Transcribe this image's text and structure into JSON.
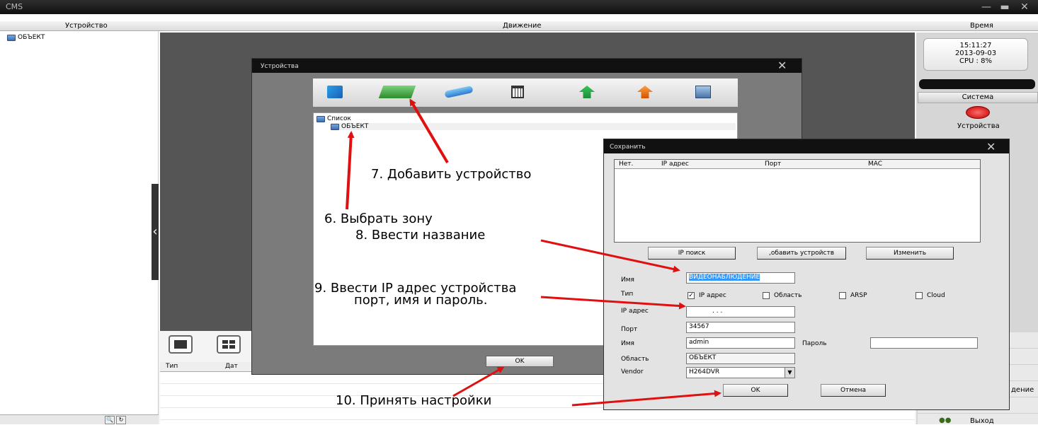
{
  "app": {
    "title": "CMS"
  },
  "columns": {
    "device": "Устройство",
    "motion": "Движение",
    "time": "Время"
  },
  "tree": {
    "root": "ОБЪЕКТ"
  },
  "log": {
    "type": "Тип",
    "date": "Дат"
  },
  "right_panel": {
    "time": "15:11:27",
    "date": "2013-09-03",
    "cpu": "CPU : 8%",
    "system": "Система",
    "devices": "Устройства",
    "exit": "Выход",
    "partial": "дение"
  },
  "devices_dialog": {
    "title": "Устройства",
    "tree_root": "Список",
    "tree_child": "ОБЪЕКТ",
    "ok": "OK",
    "tools": [
      "device-group-icon",
      "add-device-icon",
      "usb-icon",
      "delete-icon",
      "import-icon",
      "export-icon",
      "network-search-icon"
    ]
  },
  "save_dialog": {
    "title": "Сохранить",
    "columns": [
      "Нет.",
      "IP адрес",
      "Порт",
      "MAC"
    ],
    "ip_search": "IP поиск",
    "add_device": ",обавить устройств",
    "modify": "Изменить",
    "name_label": "Имя",
    "name_value": "ВИДЕОНАБЛЮДЕНИЕ",
    "type_label": "Тип",
    "type_options": [
      "IP адрес",
      "Область",
      "ARSP",
      "Cloud"
    ],
    "type_checked": "IP адрес",
    "ip_label": "IP адрес",
    "ip_value": ".   .   .",
    "port_label": "Порт",
    "port_value": "34567",
    "user_label": "Имя",
    "user_value": "admin",
    "password_label": "Пароль",
    "password_value": "",
    "area_label": "Область",
    "area_value": "ОБЪЕКТ",
    "vendor_label": "Vendor",
    "vendor_value": "H264DVR",
    "ok": "OK",
    "cancel": "Отмена"
  },
  "annotations": {
    "step6": "6. Выбрать зону",
    "step7": "7. Добавить устройство",
    "step8": "8. Ввести название",
    "step9a": "9. Ввести IP адрес устройства",
    "step9b": "порт, имя и пароль.",
    "step10": "10. Принять настройки"
  },
  "colors": {
    "arrow": "#e01010",
    "titlebar": "#111111",
    "selection": "#3399ff"
  }
}
